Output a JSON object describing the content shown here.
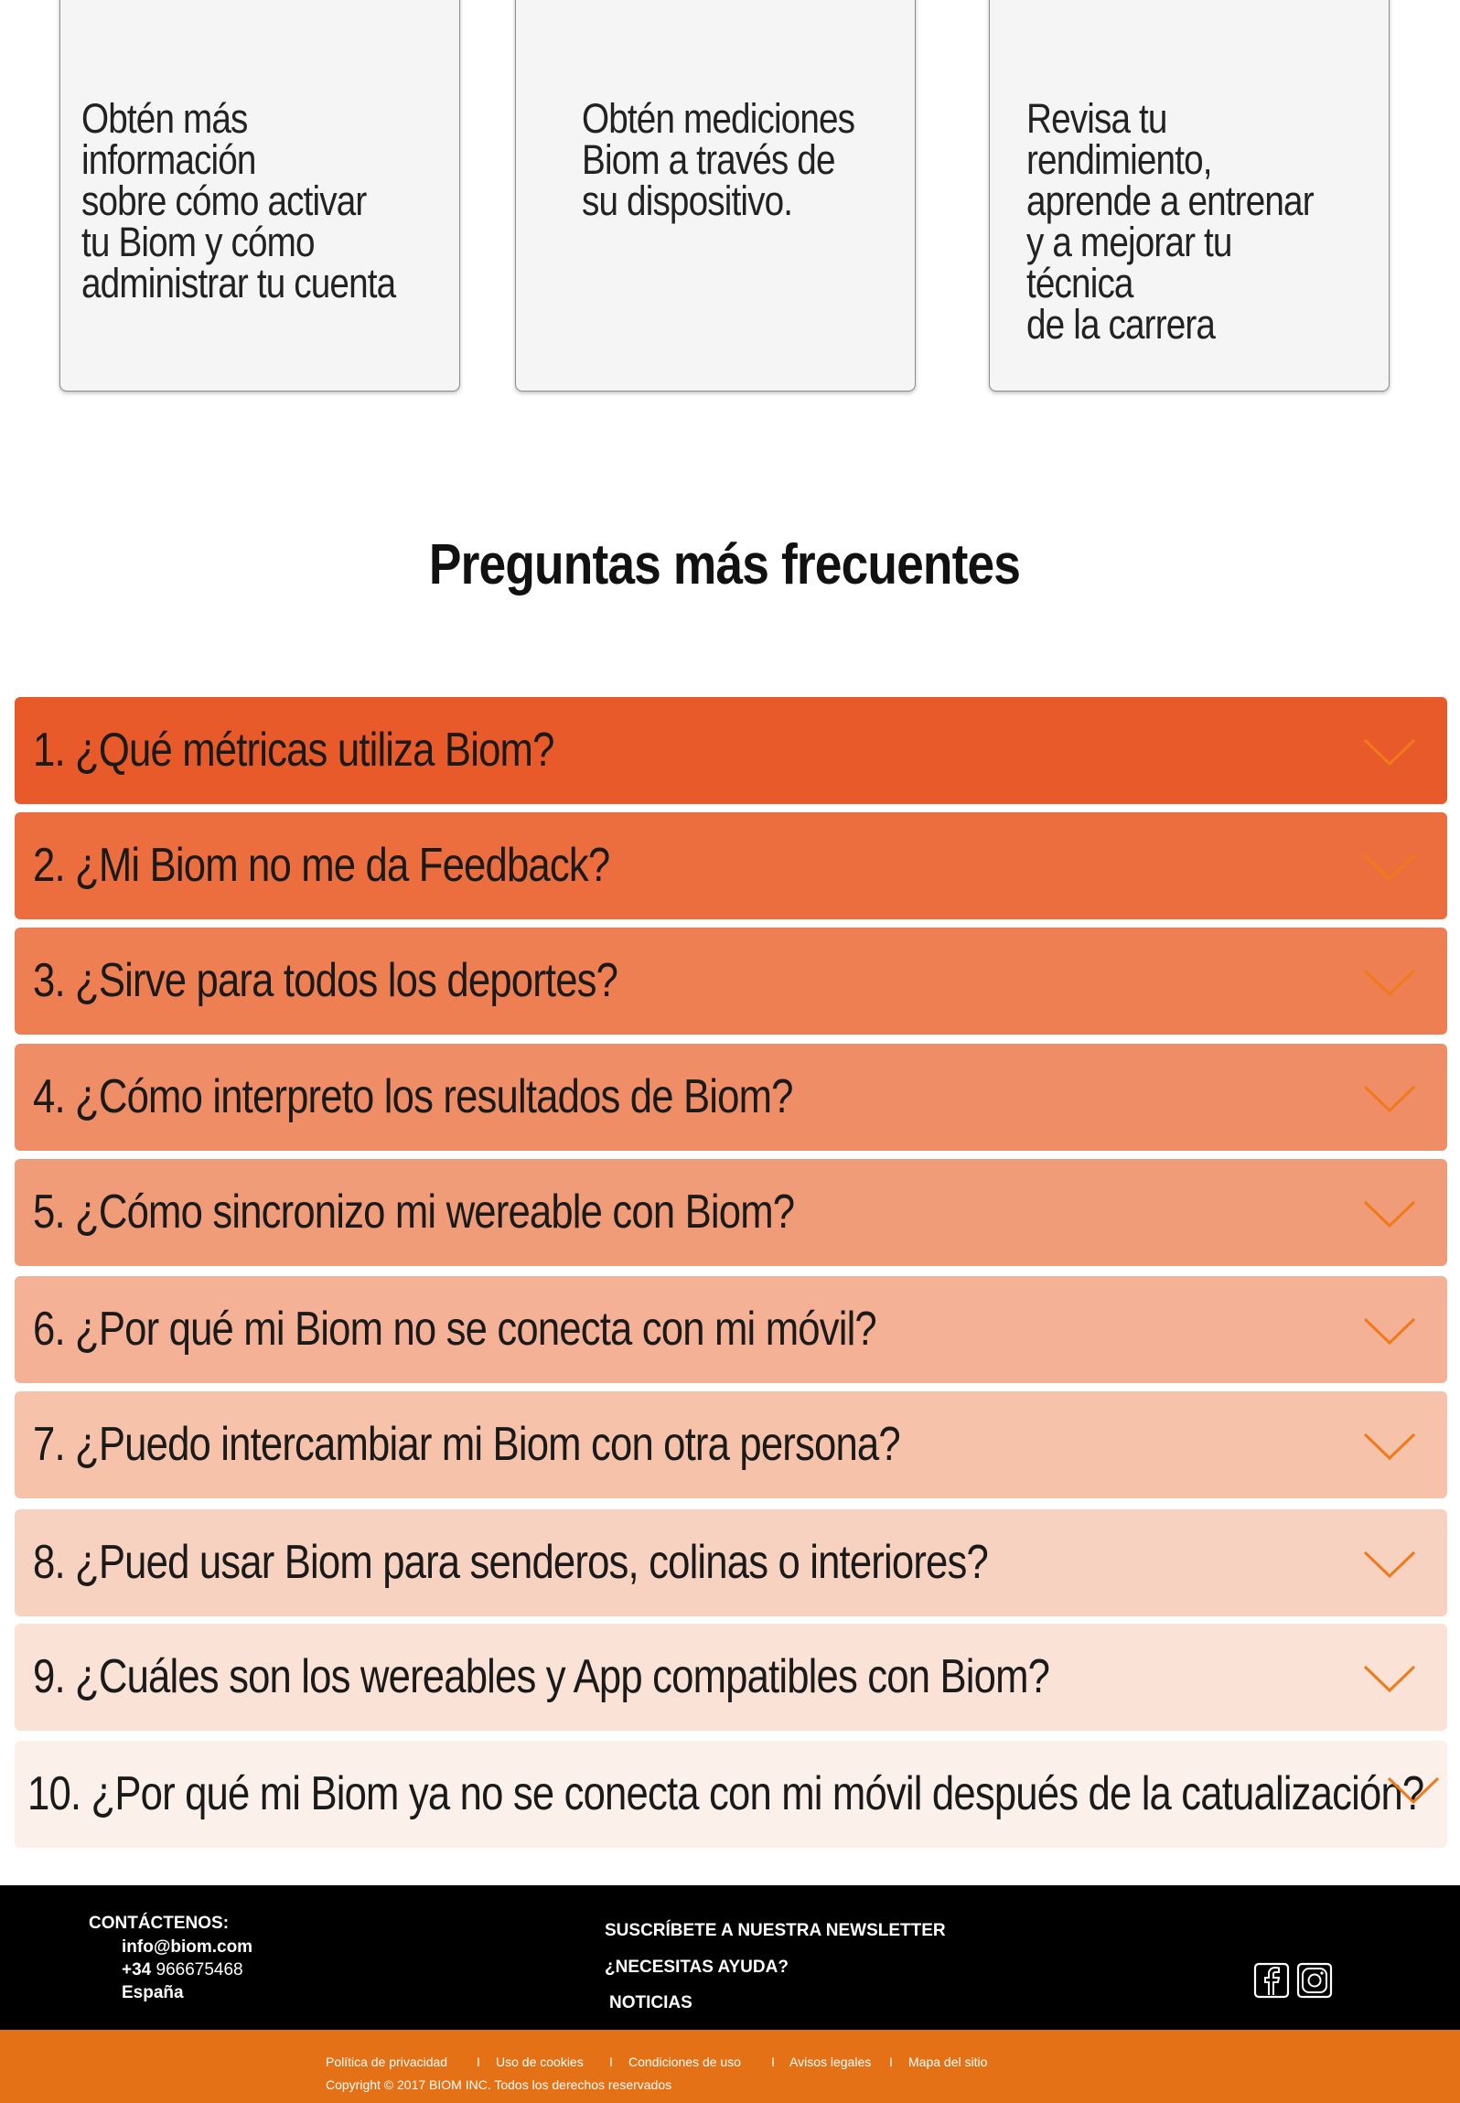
{
  "cards": [
    {
      "title": "g",
      "text": "Obtén más información\nsobre cómo activar\ntu Biom y cómo\nadministrar tu cuenta"
    },
    {
      "title": "j",
      "text": "Obtén mediciones\nBiom a través de\nsu dispositivo."
    },
    {
      "title": "p",
      "text": "Revisa tu rendimiento,\naprende a entrenar\ny a mejorar tu técnica\nde la carrera"
    }
  ],
  "faq": {
    "title": "Preguntas más frecuentes",
    "items": [
      {
        "label": "1.  ¿Qué métricas utiliza Biom?",
        "color": "#e85a2a"
      },
      {
        "label": "2.  ¿Mi Biom no me da Feedback?",
        "color": "#ec6d3e"
      },
      {
        "label": "3.  ¿Sirve para todos los deportes?",
        "color": "#ee7f53"
      },
      {
        "label": "4.  ¿Cómo interpreto los resultados de Biom?",
        "color": "#ef8e66"
      },
      {
        "label": "5.  ¿Cómo sincronizo mi wereable con Biom?",
        "color": "#f19c79"
      },
      {
        "label": "6.  ¿Por qué mi Biom no se conecta con mi móvil?",
        "color": "#f4b195"
      },
      {
        "label": "7.  ¿Puedo intercambiar mi Biom con otra persona?",
        "color": "#f6c2a9"
      },
      {
        "label": "8.  ¿Pued usar Biom para senderos, colinas o interiores?",
        "color": "#f8d2c1"
      },
      {
        "label": "9.  ¿Cuáles son los wereables y App compatibles con Biom?",
        "color": "#fae2d6"
      },
      {
        "label": "10.  ¿Por qué mi Biom ya no se conecta con mi móvil después de la catualización?",
        "color": "#fcf0ea"
      }
    ],
    "chevron_color": "#f07a1a"
  },
  "footer": {
    "contact_title": "CONTÁCTENOS:",
    "email": "info@biom.com",
    "phone_prefix": "+34",
    "phone": "966675468",
    "country": "España",
    "newsletter": "SUSCRÍBETE A NUESTRA NEWSLETTER",
    "help": "¿NECESITAS AYUDA?",
    "news": "NOTICIAS",
    "links": [
      "Política de privacidad",
      "Uso de cookies",
      "Condiciones de uso",
      "Avisos legales",
      "Mapa del sitio"
    ],
    "separator": "I",
    "copyright": "Copyright © 2017 BIOM INC. Todos los derechos reservados"
  }
}
